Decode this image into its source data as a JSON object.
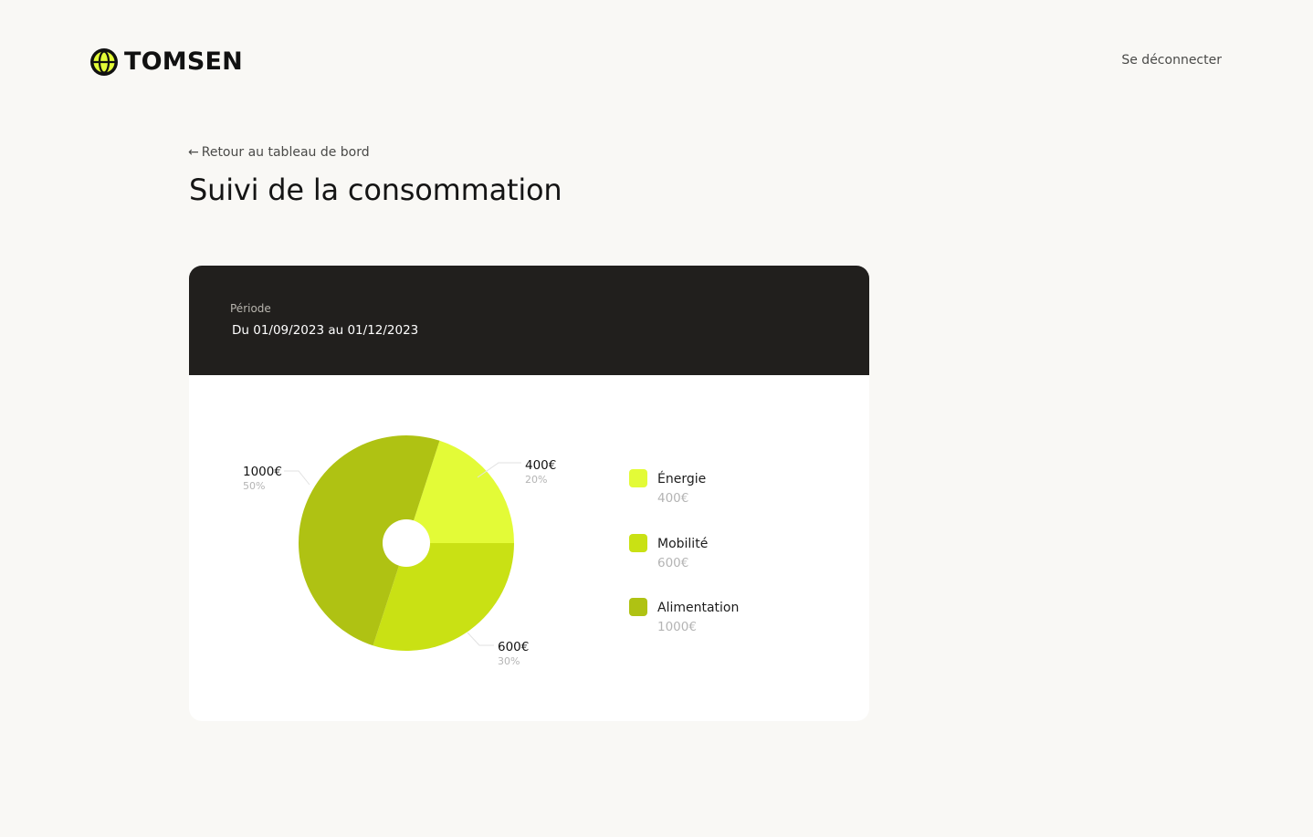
{
  "brand": {
    "name": "TOMSEN",
    "accent_color": "#e3fb37",
    "logo_icon": "globe-icon"
  },
  "header": {
    "logout_label": "Se déconnecter"
  },
  "nav": {
    "back_arrow": "←",
    "back_label": "Retour au tableau de bord"
  },
  "page": {
    "title": "Suivi de la consommation"
  },
  "card": {
    "period_label": "Période",
    "period_value": "Du 01/09/2023 au 01/12/2023"
  },
  "chart_data": {
    "type": "pie",
    "title": "",
    "donut_hole": true,
    "slices": [
      {
        "name": "Énergie",
        "value": 400,
        "value_label": "400€",
        "percent_label": "20%",
        "color": "#e3fb37"
      },
      {
        "name": "Mobilité",
        "value": 600,
        "value_label": "600€",
        "percent_label": "30%",
        "color": "#c9e114"
      },
      {
        "name": "Alimentation",
        "value": 1000,
        "value_label": "1000€",
        "percent_label": "50%",
        "color": "#afc213"
      }
    ],
    "legend_position": "right"
  }
}
